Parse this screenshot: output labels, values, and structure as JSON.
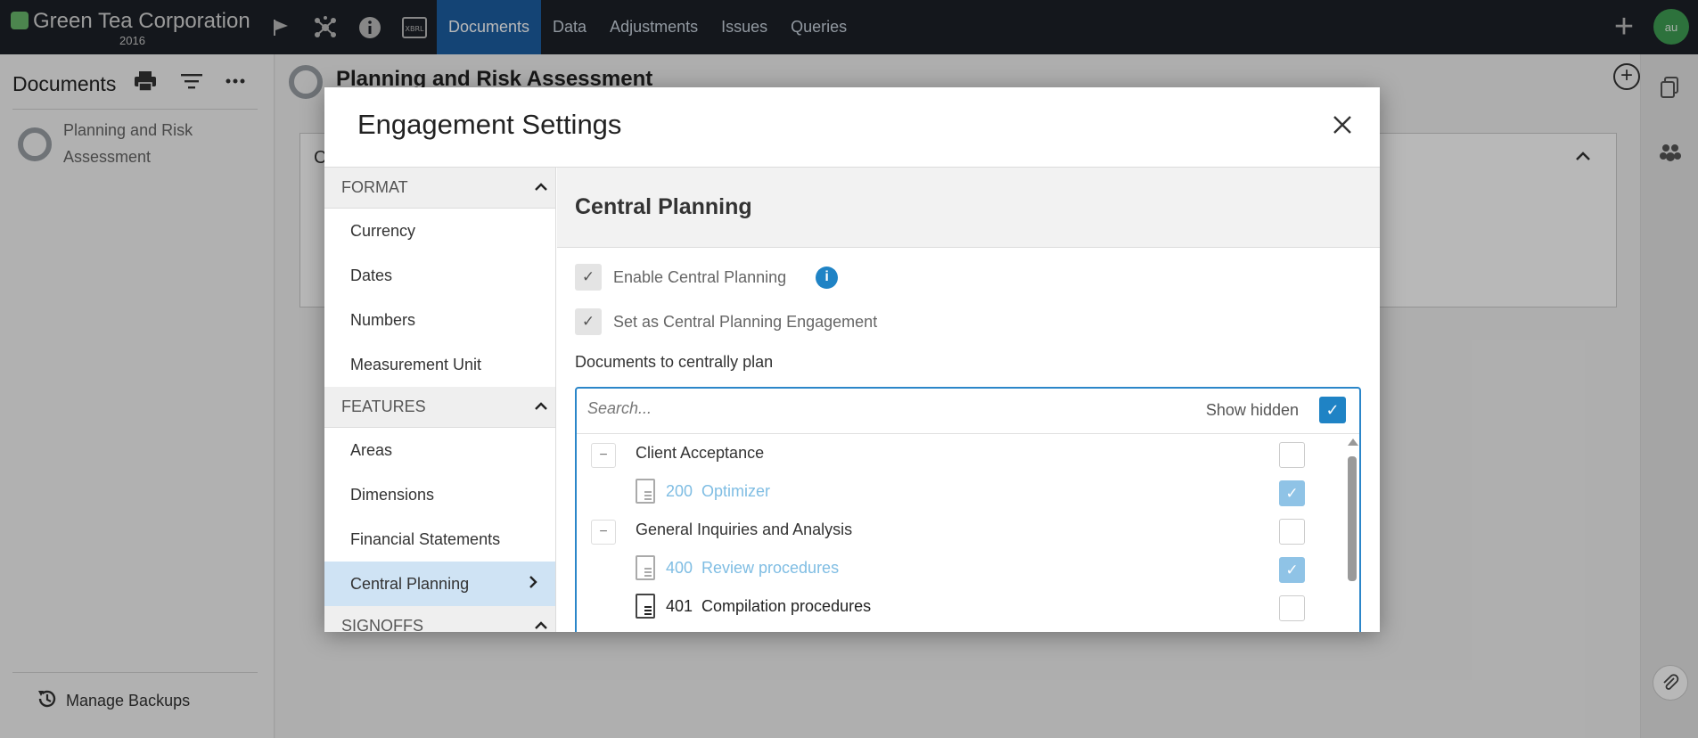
{
  "topbar": {
    "company": "Green Tea Corporation",
    "year": "2016",
    "icons": [
      "flag-icon",
      "network-icon",
      "info-icon",
      "xbrl-icon"
    ],
    "tabs": [
      {
        "label": "Documents",
        "active": true
      },
      {
        "label": "Data"
      },
      {
        "label": "Adjustments"
      },
      {
        "label": "Issues"
      },
      {
        "label": "Queries"
      }
    ],
    "avatar": "au"
  },
  "sidebar": {
    "title": "Documents",
    "document": "Planning and Risk Assessment",
    "manage_backups": "Manage Backups"
  },
  "main": {
    "title": "Planning and Risk Assessment",
    "card_letter": "C"
  },
  "modal": {
    "title": "Engagement Settings",
    "close": "×",
    "nav": {
      "format_header": "FORMAT",
      "format_items": [
        "Currency",
        "Dates",
        "Numbers",
        "Measurement Unit"
      ],
      "features_header": "FEATURES",
      "features_items": [
        "Areas",
        "Dimensions",
        "Financial Statements"
      ],
      "active_item": "Central Planning",
      "signoffs_header": "SIGNOFFS"
    },
    "content": {
      "heading": "Central Planning",
      "enable_label": "Enable Central Planning",
      "set_label": "Set as Central Planning Engagement",
      "docs_label": "Documents to centrally plan",
      "search_placeholder": "Search...",
      "show_hidden": "Show hidden",
      "tree": [
        {
          "type": "folder",
          "label": "Client Acceptance",
          "checked": false
        },
        {
          "type": "doc",
          "number": "200",
          "name": "Optimizer",
          "muted": true,
          "checked": true
        },
        {
          "type": "folder",
          "label": "General Inquiries and Analysis",
          "checked": false
        },
        {
          "type": "doc",
          "number": "400",
          "name": "Review procedures",
          "muted": true,
          "checked": true
        },
        {
          "type": "doc",
          "number": "401",
          "name": "Compilation procedures",
          "muted": false,
          "checked": false
        }
      ]
    }
  },
  "colors": {
    "topbar": "#1d2127",
    "active_tab": "#1d5fa3",
    "accent_blue": "#1f83c5",
    "muted_link": "#7fbde3",
    "active_nav_bg": "#cfe3f4"
  }
}
